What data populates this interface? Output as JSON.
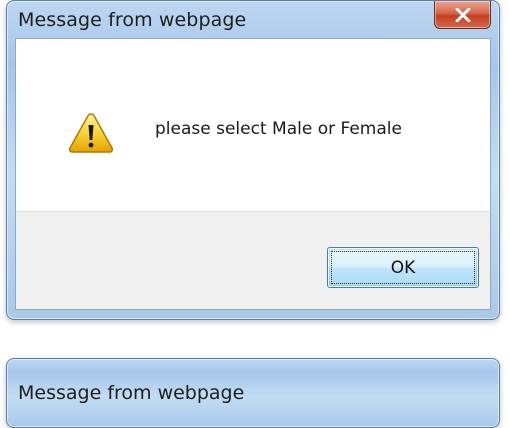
{
  "dialog": {
    "title": "Message from webpage",
    "close_icon": "close-x-icon",
    "icon": "warning-icon",
    "message": "please select Male or Female",
    "ok_label": "OK",
    "colors": {
      "frame": "#a6c6e9",
      "close_button": "#c33f20",
      "ok_button": "#bee6fd",
      "button_bar": "#f0f0f0"
    }
  },
  "second_dialog": {
    "title": "Message from webpage"
  }
}
